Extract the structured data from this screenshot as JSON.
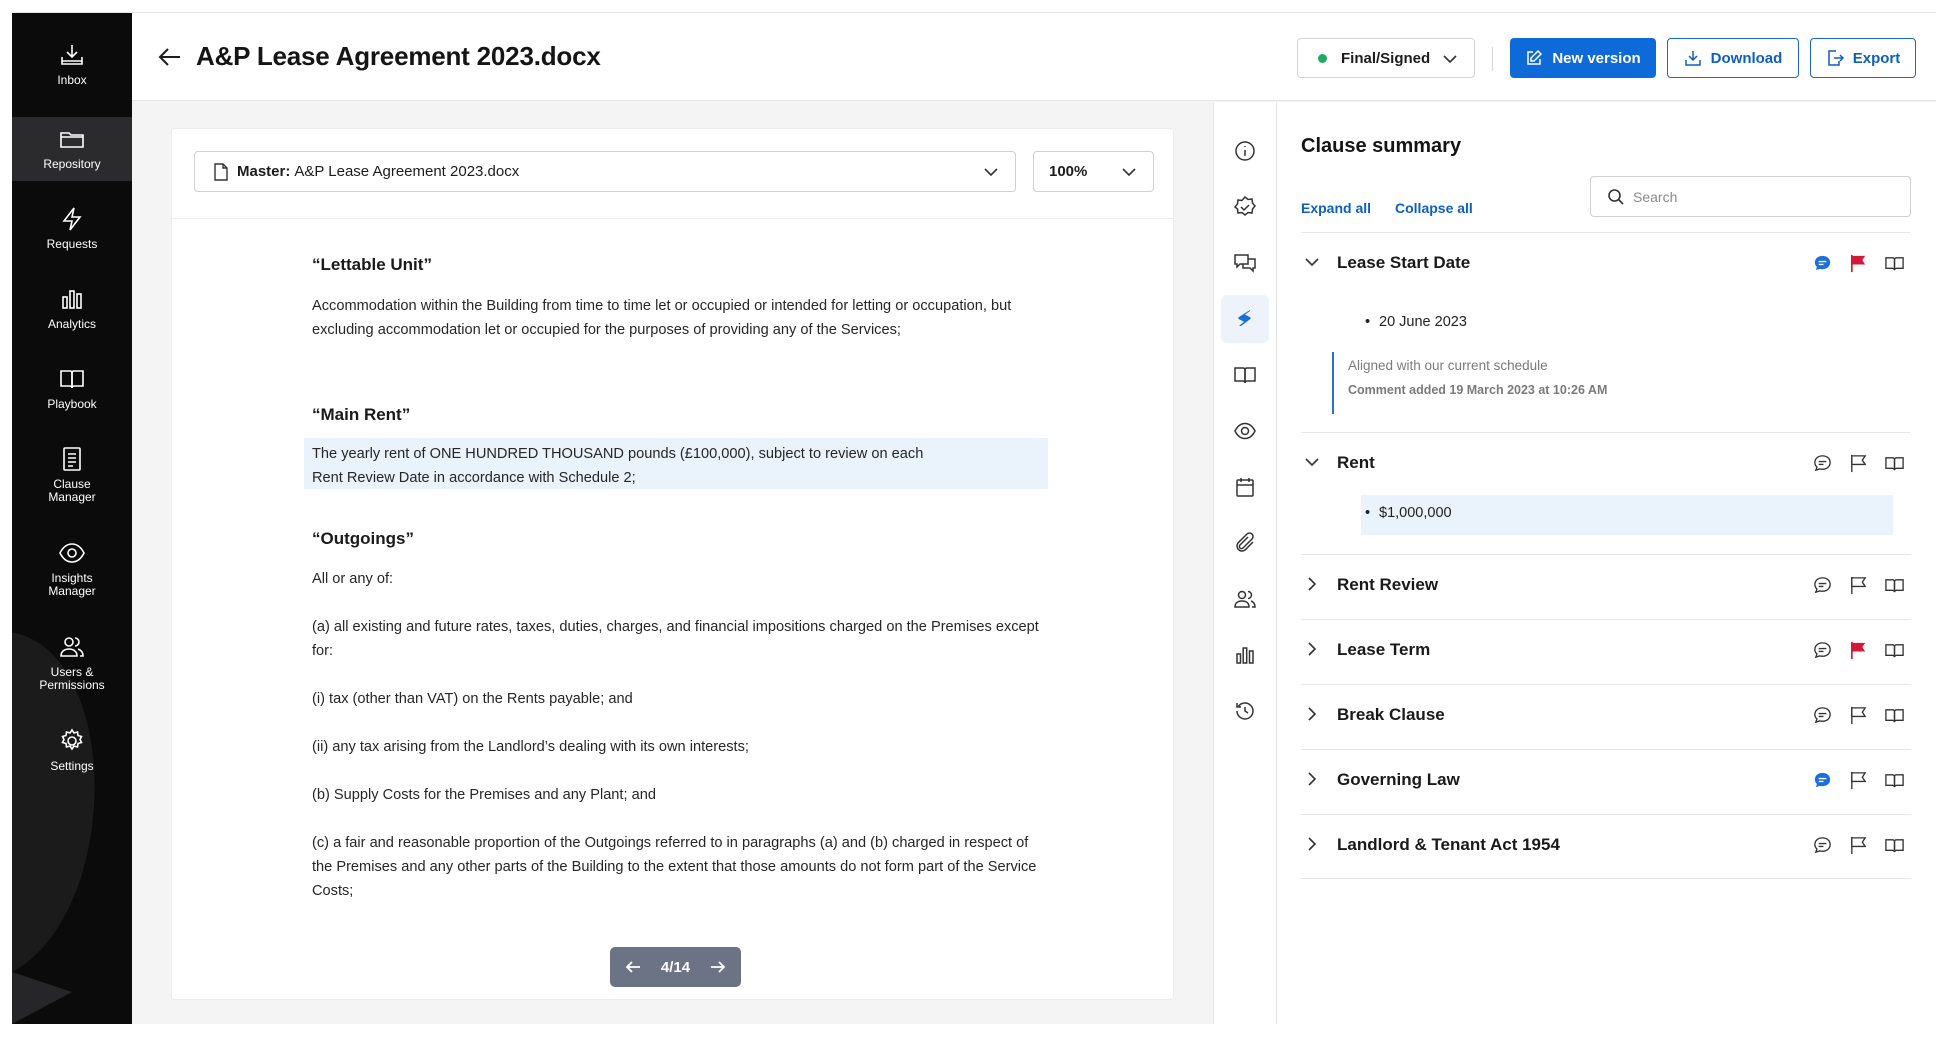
{
  "sidebar": {
    "items": [
      {
        "label": "Inbox",
        "icon": "inbox-icon"
      },
      {
        "label": "Repository",
        "icon": "folder-icon",
        "active": true
      },
      {
        "label": "Requests",
        "icon": "lightning-icon"
      },
      {
        "label": "Analytics",
        "icon": "bar-chart-icon"
      },
      {
        "label": "Playbook",
        "icon": "book-icon"
      },
      {
        "label": "Clause Manager",
        "icon": "document-icon"
      },
      {
        "label": "Insights Manager",
        "icon": "eye-icon"
      },
      {
        "label": "Users & Permissions",
        "icon": "users-icon"
      },
      {
        "label": "Settings",
        "icon": "gear-icon"
      }
    ]
  },
  "header": {
    "title": "A&P Lease Agreement 2023.docx",
    "status": "Final/Signed",
    "status_color": "#1dab62",
    "new_version": "New version",
    "download": "Download",
    "export": "Export"
  },
  "document": {
    "master_label": "Master:",
    "master_file": "A&P Lease Agreement 2023.docx",
    "zoom": "100%",
    "pager": "4/14",
    "content": {
      "h1": "“Lettable Unit”",
      "p1": "Accommodation within the Building from time to time let or occupied or intended for letting or occupation, but excluding accommodation let or occupied for the purposes of providing any of the Services;",
      "h2": "“Main Rent”",
      "p2": "The yearly rent of ONE HUNDRED THOUSAND pounds (£100,000), subject to review on each Rent Review Date in accordance with Schedule 2;",
      "h3": "“Outgoings”",
      "p3": "All or any of:",
      "p4": "(a) all existing and future rates, taxes, duties, charges, and financial impositions charged on the Premises except for:",
      "p5": "(i) tax (other than VAT) on the Rents payable; and",
      "p6": "(ii) any tax arising from the Landlord’s dealing with its own interests;",
      "p7": "(b) Supply Costs for the Premises and any Plant; and",
      "p8": "(c) a fair and reasonable proportion of the Outgoings referred to in paragraphs (a) and (b) charged in respect of the Premises and any other parts of the Building to the extent that those amounts do not form part of the Service Costs;"
    }
  },
  "rail": [
    "info-icon",
    "check-badge-icon",
    "chat-icon",
    "logo-s-icon",
    "book-open-icon",
    "eye-icon",
    "calendar-icon",
    "paperclip-icon",
    "people-icon",
    "bar-chart-icon",
    "history-icon"
  ],
  "clause_summary": {
    "title": "Clause summary",
    "expand_all": "Expand all",
    "collapse_all": "Collapse all",
    "search_placeholder": "Search",
    "clauses": [
      {
        "name": "Lease Start Date",
        "expanded": true,
        "value": "20 June 2023",
        "comment_active": true,
        "flagged": true,
        "comment": {
          "text": "Aligned with our current schedule",
          "meta": "Comment added 19 March 2023 at 10:26 AM"
        }
      },
      {
        "name": "Rent",
        "expanded": true,
        "value": "$1,000,000",
        "comment_active": false,
        "flagged": false
      },
      {
        "name": "Rent Review",
        "expanded": false,
        "comment_active": false,
        "flagged": false
      },
      {
        "name": "Lease Term",
        "expanded": false,
        "comment_active": false,
        "flagged": true
      },
      {
        "name": "Break Clause",
        "expanded": false,
        "comment_active": false,
        "flagged": false
      },
      {
        "name": "Governing Law",
        "expanded": false,
        "comment_active": true,
        "flagged": false
      },
      {
        "name": "Landlord & Tenant Act 1954",
        "expanded": false,
        "comment_active": false,
        "flagged": false
      }
    ]
  },
  "colors": {
    "accent": "#0e6ad8",
    "flag": "#d2193a",
    "comment_active": "#1c6fd6"
  }
}
